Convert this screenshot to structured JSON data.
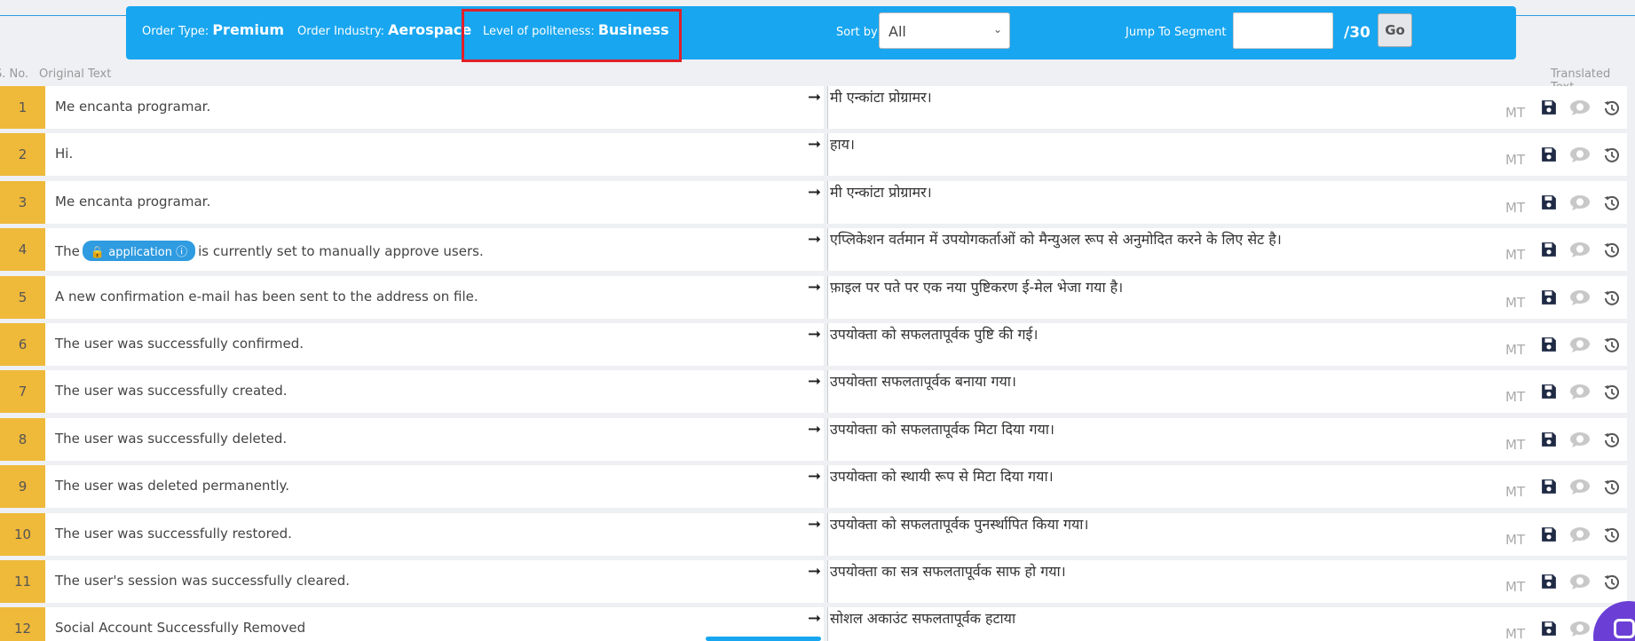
{
  "header": {
    "order_type_label": "Order Type:",
    "order_type_value": "Premium",
    "order_industry_label": "Order Industry:",
    "order_industry_value": "Aerospace",
    "politeness_label": "Level of politeness:",
    "politeness_value": "Business",
    "sort_label": "Sort by",
    "sort_value": "All",
    "jump_label": "Jump To Segment",
    "jump_value": "",
    "total_segments": "/30",
    "go_label": "Go"
  },
  "columns": {
    "sno": "S. No.",
    "original": "Original Text",
    "translated": "Translated Text"
  },
  "row_action_mt": "MT",
  "comment_count": "0",
  "rows": [
    {
      "num": "1",
      "original": "Me encanta programar.",
      "translated": "मी एन्कांटा प्रोग्रामर।"
    },
    {
      "num": "2",
      "original": "Hi.",
      "translated": "हाय।"
    },
    {
      "num": "3",
      "original": "Me encanta programar.",
      "translated": "मी एन्कांटा प्रोग्रामर।"
    },
    {
      "num": "4",
      "original_before": "The",
      "tag": "application",
      "original_after": "is currently set to manually approve users.",
      "translated": "एप्लिकेशन वर्तमान में उपयोगकर्ताओं को मैन्युअल रूप से अनुमोदित करने के लिए सेट है।"
    },
    {
      "num": "5",
      "original": "A new confirmation e-mail has been sent to the address on file.",
      "translated": "फ़ाइल पर पते पर एक नया पुष्टिकरण ई-मेल भेजा गया है।"
    },
    {
      "num": "6",
      "original": "The user was successfully confirmed.",
      "translated": "उपयोक्ता को सफलतापूर्वक पुष्टि की गई।"
    },
    {
      "num": "7",
      "original": "The user was successfully created.",
      "translated": "उपयोक्ता सफलतापूर्वक बनाया गया।"
    },
    {
      "num": "8",
      "original": "The user was successfully deleted.",
      "translated": "उपयोक्ता को सफलतापूर्वक मिटा दिया गया।"
    },
    {
      "num": "9",
      "original": "The user was deleted permanently.",
      "translated": "उपयोक्ता को स्थायी रूप से मिटा दिया गया।"
    },
    {
      "num": "10",
      "original": "The user was successfully restored.",
      "translated": "उपयोक्ता को सफलतापूर्वक पुनर्स्थापित किया गया।"
    },
    {
      "num": "11",
      "original": "The user's session was successfully cleared.",
      "translated": "उपयोक्ता का सत्र सफलतापूर्वक साफ हो गया।"
    },
    {
      "num": "12",
      "original": "Social Account Successfully Removed",
      "translated": "सोशल अकाउंट सफलतापूर्वक हटाया"
    }
  ]
}
